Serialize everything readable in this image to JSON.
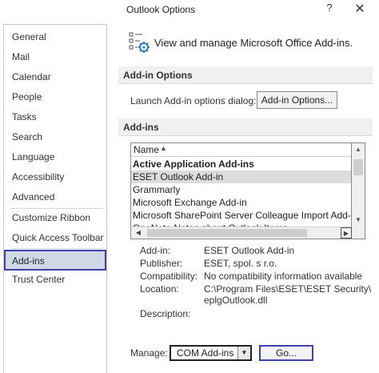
{
  "window": {
    "title": "Outlook Options",
    "help_glyph": "?",
    "close_glyph": "✕"
  },
  "sidebar": {
    "items": [
      {
        "label": "General"
      },
      {
        "label": "Mail"
      },
      {
        "label": "Calendar"
      },
      {
        "label": "People"
      },
      {
        "label": "Tasks"
      },
      {
        "label": "Search"
      },
      {
        "label": "Language"
      },
      {
        "label": "Accessibility"
      },
      {
        "label": "Advanced"
      },
      {
        "label": "Customize Ribbon"
      },
      {
        "label": "Quick Access Toolbar"
      },
      {
        "label": "Add-ins"
      },
      {
        "label": "Trust Center"
      }
    ],
    "selected": "Add-ins"
  },
  "main": {
    "header_text": "View and manage Microsoft Office Add-ins.",
    "header_icon": "addins-gear-icon",
    "addin_options": {
      "title": "Add-in Options",
      "launch_text": "Launch Add-in options dialog:",
      "button_label": "Add-in Options..."
    },
    "addins": {
      "title": "Add-ins",
      "column_header": "Name",
      "rows": [
        {
          "text": "Active Application Add-ins",
          "group": true
        },
        {
          "text": "ESET Outlook Add-in",
          "selected": true
        },
        {
          "text": "Grammarly"
        },
        {
          "text": "Microsoft Exchange Add-in"
        },
        {
          "text": "Microsoft SharePoint Server Colleague Import Add-in"
        },
        {
          "text": "OneNote Notes about Outlook Items"
        }
      ]
    },
    "details": {
      "addin_label": "Add-in:",
      "addin_value": "ESET Outlook Add-in",
      "publisher_label": "Publisher:",
      "publisher_value": "ESET, spol. s r.o.",
      "compat_label": "Compatibility:",
      "compat_value": "No compatibility information available",
      "location_label": "Location:",
      "location_value_1": "C:\\Program Files\\ESET\\ESET Security\\",
      "location_value_2": "eplgOutlook.dll",
      "description_label": "Description:"
    },
    "manage": {
      "label": "Manage:",
      "selected": "COM Add-ins",
      "go_label": "Go..."
    }
  },
  "colors": {
    "selection_border": "#3f3fb0",
    "selection_bg": "#cfd8e6"
  }
}
